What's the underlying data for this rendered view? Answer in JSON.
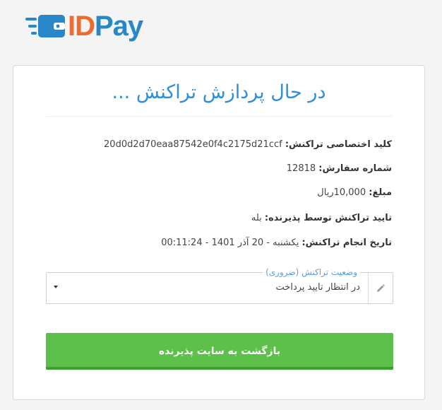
{
  "brand": {
    "logo_id": "ID",
    "logo_pay": "Pay",
    "colors": {
      "orange": "#ef6a2d",
      "blue": "#2787c8"
    }
  },
  "card": {
    "title": "در حال پردازش تراکنش ...",
    "fields": {
      "private_key": {
        "label": "کلید اختصاصی تراکنش:",
        "value": "20d0d2d70eaa87542e0f4c2175d21ccf"
      },
      "order_number": {
        "label": "شماره سفارش:",
        "value": "12818"
      },
      "amount": {
        "label": "مبلغ:",
        "value": "10,000",
        "unit": "ریال"
      },
      "merchant_confirm": {
        "label": "تایید تراکنش توسط پذیرنده:",
        "value": "بله"
      },
      "transaction_date": {
        "label": "تاریخ انجام تراکنش:",
        "value": "یکشنبه - 20 آذر 1401 - 00:11:24"
      }
    },
    "status_select": {
      "legend": "وضعیت تراکنش (ضروری)",
      "value": "در انتظار تایید پرداخت",
      "icon": "pencil-icon"
    },
    "back_button": {
      "label": "بازگشت به سایت پذیرنده",
      "color": "#5cc04a"
    },
    "title_color": "#2f8fd6"
  }
}
